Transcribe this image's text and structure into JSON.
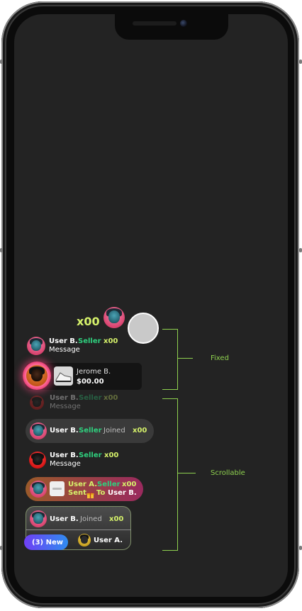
{
  "host": {
    "count": "x00"
  },
  "fixed_messages": [
    {
      "user": "User B.",
      "role": "Seller",
      "count": "x00",
      "message": "Message"
    }
  ],
  "product": {
    "name": "Jerome B.",
    "price": "$00.00"
  },
  "faded_row": {
    "user": "User B.",
    "role": "Seller",
    "count": "x00",
    "message": "Message"
  },
  "scroll_messages": {
    "joined_pill": {
      "user": "User B.",
      "role": "Seller",
      "action": "Joined",
      "count": "x00"
    },
    "plain_message": {
      "user": "User B.",
      "role": "Seller",
      "count": "x00",
      "message": "Message"
    },
    "gift": {
      "user": "User A.",
      "role": "Seller",
      "count": "x00",
      "sent": "Sent",
      "to": "To",
      "recipient": "User B.",
      "gift_icon": "gift-icon"
    },
    "last_joined": {
      "user": "User B.",
      "action": "Joined",
      "count": "x00"
    },
    "new_badge": "(3) New",
    "footer_user": "User A."
  },
  "annotations": {
    "fixed": "Fixed",
    "scrollable": "Scrollable"
  },
  "colors": {
    "seller_green": "#2fd07e",
    "count_lime": "#d6f26b",
    "guide_line": "#8fd14f",
    "new_badge_start": "#6f3ff5",
    "new_badge_end": "#2f8cf0",
    "gift_bg_start": "#9a5a2a",
    "gift_bg_end": "#9a2a5e"
  }
}
